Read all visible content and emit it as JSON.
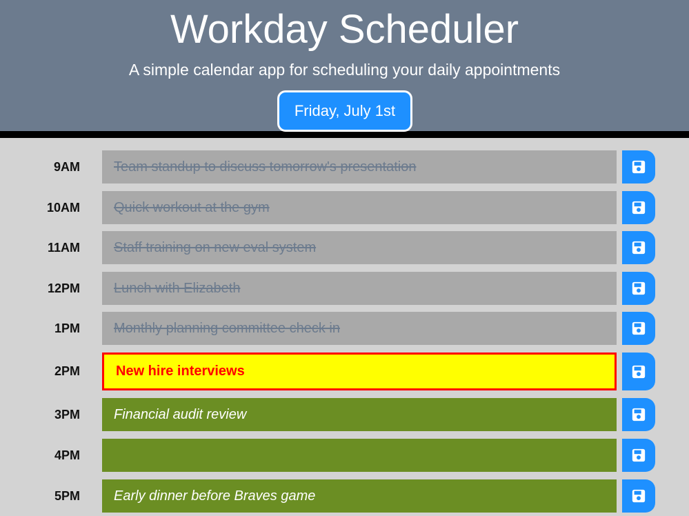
{
  "header": {
    "title": "Workday Scheduler",
    "subtitle": "A simple calendar app for scheduling your daily appointments",
    "current_date": "Friday, July 1st"
  },
  "colors": {
    "header_bg": "#6c7b8e",
    "past": "#a9a9a9",
    "present": "#ffff00",
    "present_text": "#ff0000",
    "future": "#6b8e23",
    "save_button": "#1e90ff"
  },
  "rows": [
    {
      "hour": "9AM",
      "text": "Team standup to discuss tomorrow's presentation",
      "status": "past",
      "save_icon": "floppy-disk-icon"
    },
    {
      "hour": "10AM",
      "text": "Quick workout at the gym",
      "status": "past",
      "save_icon": "floppy-disk-icon"
    },
    {
      "hour": "11AM",
      "text": "Staff training on new eval system",
      "status": "past",
      "save_icon": "floppy-disk-icon"
    },
    {
      "hour": "12PM",
      "text": "Lunch with Elizabeth",
      "status": "past",
      "save_icon": "floppy-disk-icon"
    },
    {
      "hour": "1PM",
      "text": "Monthly planning committee check in",
      "status": "past",
      "save_icon": "floppy-disk-icon"
    },
    {
      "hour": "2PM",
      "text": "New hire interviews",
      "status": "present",
      "save_icon": "floppy-disk-icon"
    },
    {
      "hour": "3PM",
      "text": "Financial audit review",
      "status": "future",
      "save_icon": "floppy-disk-icon"
    },
    {
      "hour": "4PM",
      "text": "",
      "status": "future",
      "save_icon": "floppy-disk-icon"
    },
    {
      "hour": "5PM",
      "text": "Early dinner before Braves game",
      "status": "future",
      "save_icon": "floppy-disk-icon"
    }
  ]
}
